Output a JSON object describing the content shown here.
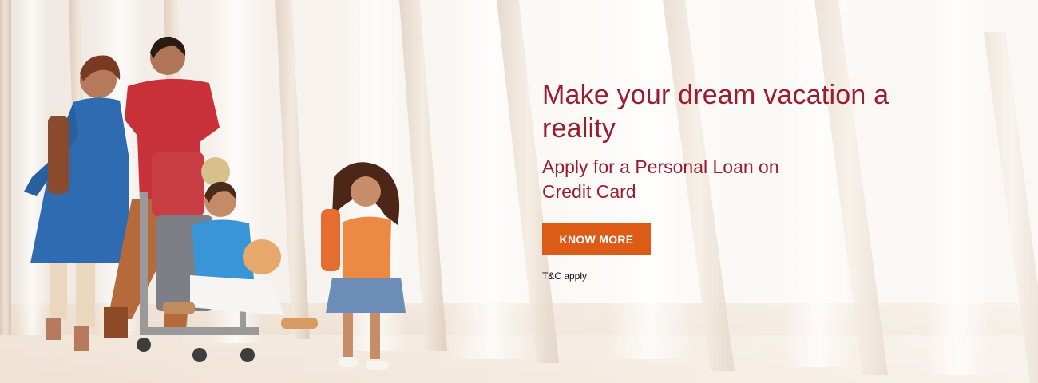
{
  "banner": {
    "headline": "Make your dream vacation a reality",
    "subheadline": "Apply for a Personal Loan on Credit Card",
    "cta_label": "KNOW MORE",
    "terms": "T&C apply",
    "image": "family-walking-with-luggage-trolley-airport-photo"
  },
  "colors": {
    "headline": "#9b1c31",
    "cta_background": "#db5b17",
    "cta_text": "#ffffff",
    "terms": "#111111"
  }
}
